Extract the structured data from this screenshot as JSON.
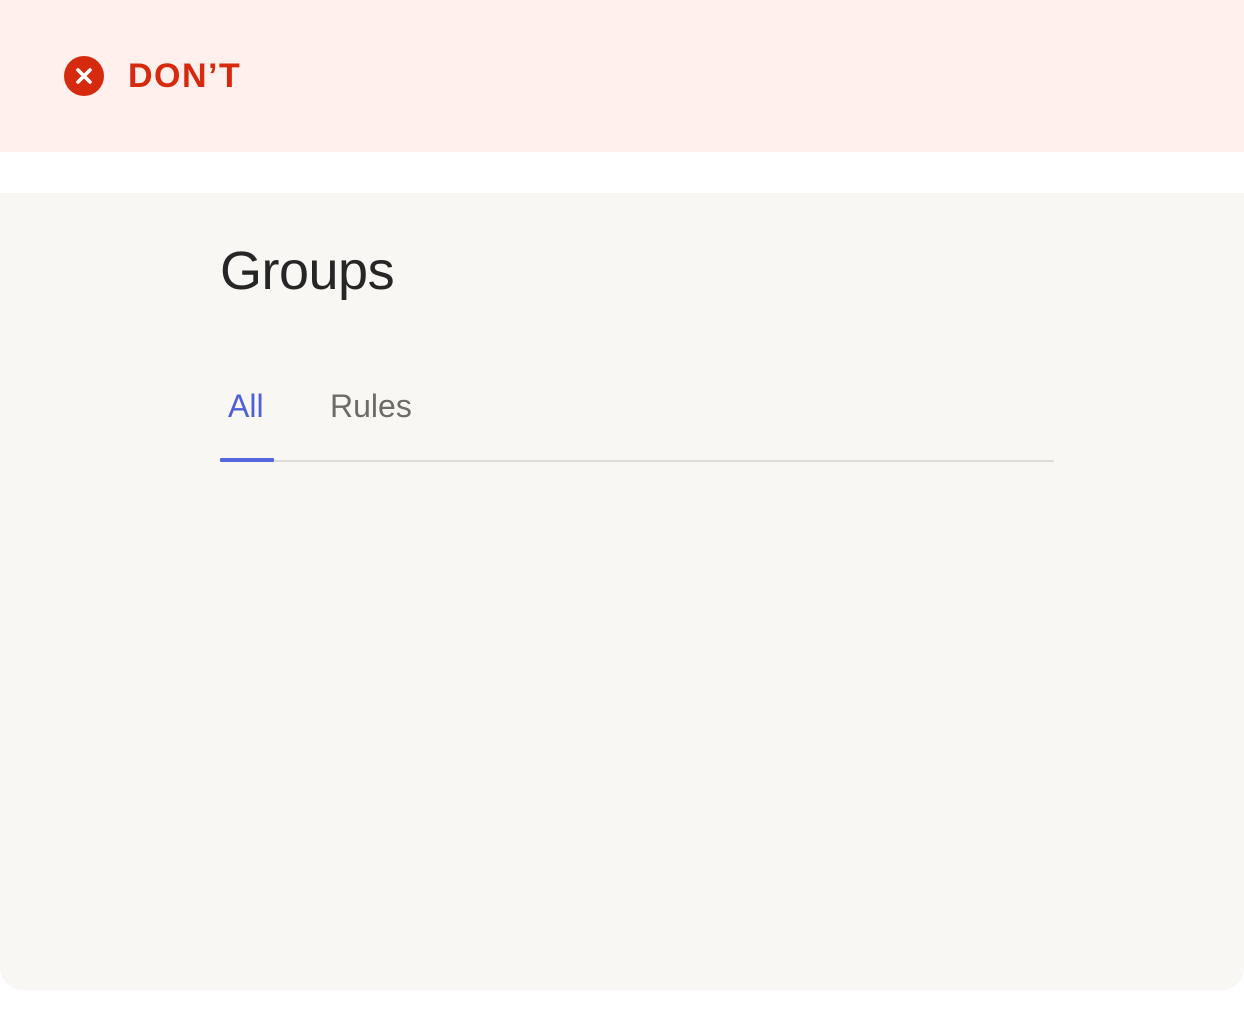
{
  "banner": {
    "label": "DON’T",
    "icon": "close-circle-icon",
    "color": "#d62a0f",
    "background": "#fff0ed"
  },
  "panel": {
    "background": "#f8f7f4"
  },
  "page": {
    "title": "Groups"
  },
  "tabs": {
    "items": [
      {
        "label": "All",
        "selected": true
      },
      {
        "label": "Rules",
        "selected": false
      }
    ],
    "accent": "#5266dd"
  }
}
